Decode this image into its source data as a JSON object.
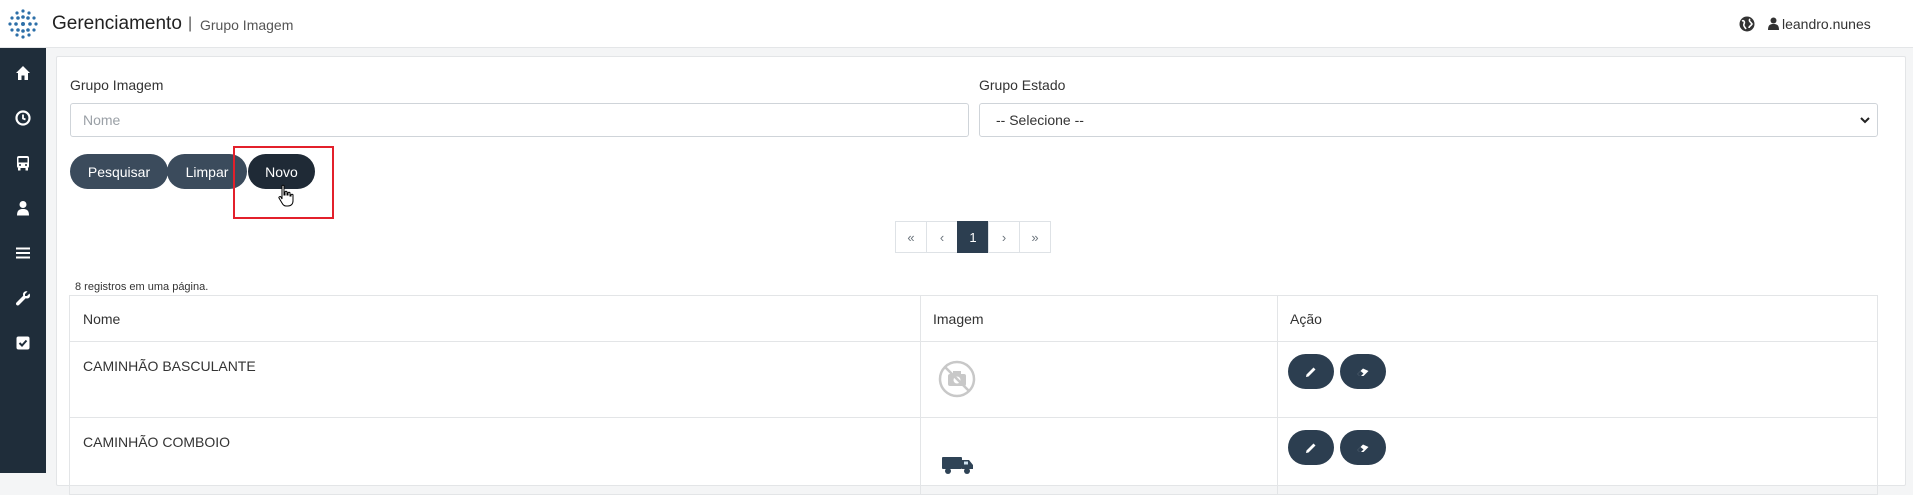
{
  "header": {
    "app_title": "Gerenciamento",
    "separator": "|",
    "page_subtitle": "Grupo Imagem",
    "user_name": "leandro.nunes"
  },
  "sidebar": {
    "items": [
      {
        "icon": "home-icon"
      },
      {
        "icon": "clock-icon"
      },
      {
        "icon": "bus-icon"
      },
      {
        "icon": "user-icon"
      },
      {
        "icon": "menu-icon"
      },
      {
        "icon": "wrench-icon"
      },
      {
        "icon": "checkbox-icon"
      }
    ]
  },
  "filters": {
    "grupo_imagem_label": "Grupo Imagem",
    "grupo_imagem_placeholder": "Nome",
    "grupo_estado_label": "Grupo Estado",
    "grupo_estado_selected": "-- Selecione --"
  },
  "actions": {
    "pesquisar": "Pesquisar",
    "limpar": "Limpar",
    "novo": "Novo"
  },
  "pagination": {
    "first": "«",
    "prev": "‹",
    "current": "1",
    "next": "›",
    "last": "»"
  },
  "table": {
    "record_count": "8 registros em uma página.",
    "headers": [
      "Nome",
      "Imagem",
      "Ação"
    ],
    "rows": [
      {
        "nome": "CAMINHÃO BASCULANTE",
        "image": "no-image-icon"
      },
      {
        "nome": "CAMINHÃO COMBOIO",
        "image": "truck-icon"
      }
    ]
  },
  "colors": {
    "sidebar_bg": "#1f2d3a",
    "button_bg": "#3b4b5c",
    "highlight": "#e3202b"
  }
}
